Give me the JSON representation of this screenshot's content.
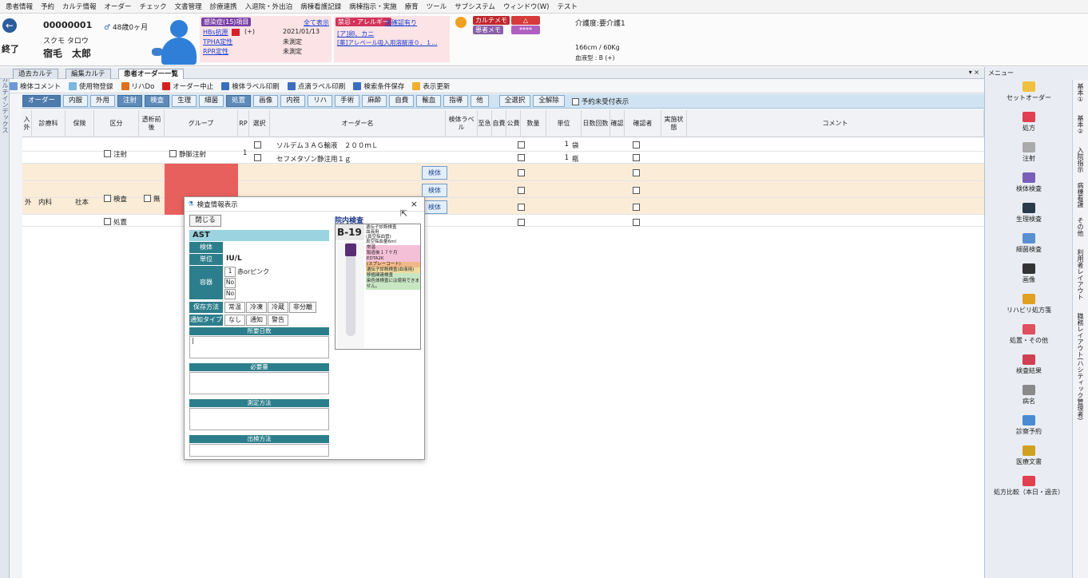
{
  "menu": [
    "患者情報",
    "予約",
    "カルテ情報",
    "オーダー",
    "チェック",
    "文書管理",
    "診療連携",
    "入退院・外出泊",
    "病棟看護記録",
    "病棟指示・実施",
    "療育",
    "ツール",
    "サブシステム",
    "ウィンドウ(W)",
    "テスト"
  ],
  "patient": {
    "end_label": "終了",
    "id": "00000001",
    "age": "48歳0ヶ月",
    "kana": "スクモ タロウ",
    "name": "宿毛　太郎",
    "infection_title": "感染症(15)項目",
    "show_all": "全て表示",
    "infections": [
      {
        "name": "HBs抗原",
        "value": "(+)",
        "date": "2021/01/13"
      },
      {
        "name": "TPHA定性",
        "value": "",
        "date": "未測定"
      },
      {
        "name": "RPR定性",
        "value": "",
        "date": "未測定"
      }
    ],
    "allergy_title": "禁忌・アレルギー",
    "allergy_confirm": "未確認有り",
    "allergy_items": [
      "[ア]卵、カニ",
      "[薬]アレベール吸入用溶解液０．１..."
    ],
    "karte_memo": "カルテメモ",
    "patient_memo": "患者メモ",
    "delta": "△",
    "stars": "****",
    "care": "介護度:要介護1",
    "body": "166cm / 60Kg",
    "blood": "血液型 : B (+)"
  },
  "tabs": [
    "過去カルテ",
    "編集カルテ",
    "患者オーダー一覧"
  ],
  "close_x": "▾ ×",
  "toolbar": [
    "検体コメント",
    "使用物登録",
    "リハDo",
    "オーダー中止",
    "検体ラベル印刷",
    "点滴ラベル印刷",
    "検索条件保存",
    "表示更新"
  ],
  "side_label": "カルテインデックス",
  "categories": [
    "オーダー",
    "内服",
    "外用",
    "注射",
    "検査",
    "生理",
    "細菌",
    "処置",
    "画像",
    "内視",
    "リハ",
    "手術",
    "麻酔",
    "自費",
    "輸血",
    "指導",
    "他",
    "全選択",
    "全解除"
  ],
  "reserve_label": "予約未受付表示",
  "headers": {
    "nyu": "入外",
    "dept": "診療科",
    "ins": "保険",
    "kubun": "区分",
    "dialysis": "透析前後",
    "group": "グループ",
    "rp": "RP",
    "sel": "選択",
    "order": "オーダー名",
    "label": "検体ラベル",
    "urgent": "至急",
    "self": "自費",
    "public": "公費",
    "qty": "数量",
    "unit": "単位",
    "days": "日数回数",
    "confirm": "確認",
    "confirmer": "確認者",
    "status": "実施状態",
    "comment": "コメント"
  },
  "rows": {
    "nyu": "外",
    "dept": "内科",
    "ins": "社本",
    "k1": "注射",
    "k2": "検査",
    "k2b": "無",
    "k3": "処置",
    "g1": "静脈注射",
    "rp1": "1",
    "o1": "ソルデム３ＡＧ輸液　２００ｍＬ",
    "q1": "1",
    "u1": "袋",
    "o2": "セフメタゾン静注用１ｇ",
    "q2": "1",
    "u2": "瓶",
    "kentai": "検体"
  },
  "dialog": {
    "title": "検査情報表示",
    "close_btn": "閉じる",
    "test": "AST",
    "kentai_lbl": "検体",
    "unit_lbl": "単位",
    "unit_val": "IU/L",
    "container_lbl": "容器",
    "c1n": "1",
    "c1": "赤orピンク",
    "c2": "No",
    "c3": "No",
    "storage_lbl": "保存方法",
    "storage": [
      "常温",
      "冷凍",
      "冷蔵",
      "非分離"
    ],
    "notify_lbl": "通知タイプ",
    "notify": [
      "なし",
      "通知",
      "警告"
    ],
    "days_lbl": "所要日数",
    "amount_lbl": "必要量",
    "method_lbl": "測定方法",
    "submit_lbl": "出検方法",
    "days_val": "|",
    "inhouse": "院内検査",
    "tube_code": "B-19",
    "tube_lines": [
      "遺伝子診断検査",
      "血液用",
      "(真空採血管)",
      "真空採血量6ml"
    ],
    "tube_notes": [
      "常温",
      "製造後１７ケ月",
      "EDTA2K",
      "(スプレーコート)",
      "遺伝子診断検査(血液用)",
      "移植関連検査",
      "染色体検査には使用できません。"
    ]
  },
  "rmenu": {
    "title": "メニュー",
    "items": [
      "セットオーダー",
      "処方",
      "注射",
      "検体検査",
      "生理検査",
      "細菌検査",
      "画像",
      "リハビリ処方箋",
      "処置・その他",
      "検査結果",
      "病名",
      "診察予約",
      "医療文書",
      "処方比較（本日・過去）"
    ]
  },
  "rstrip": [
    "基本①",
    "基本②",
    "入院指示",
    "病棟看護",
    "その他",
    "利用者レイアウト",
    "職務レイアウト(ハシティック管理者)"
  ]
}
